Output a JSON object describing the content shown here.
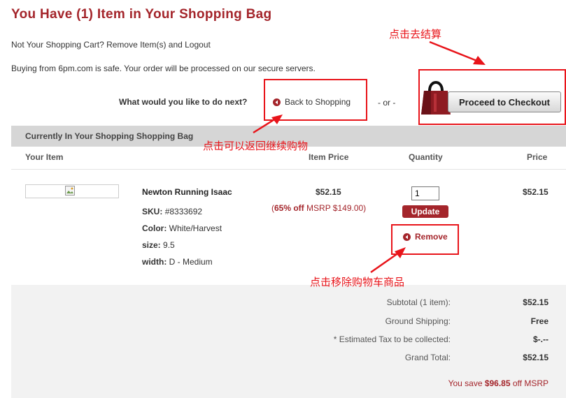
{
  "header": {
    "title": "You Have (1) Item in Your Shopping Bag",
    "not_your_cart": "Not Your Shopping Cart? Remove Item(s) and Logout",
    "secure_note": "Buying from 6pm.com is safe. Your order will be processed on our secure servers."
  },
  "next_steps": {
    "question": "What would you like to do next?",
    "back_label": "Back to Shopping",
    "or_label": "- or -",
    "checkout_label": "Proceed to Checkout"
  },
  "annotations": {
    "checkout": "点击去结算",
    "back": "点击可以返回继续购物",
    "remove": "点击移除购物车商品",
    "color": "#e8141a"
  },
  "table": {
    "heading": "Currently In Your Shopping Shopping Bag",
    "columns": [
      "Your Item",
      "Item Price",
      "Quantity",
      "Price"
    ]
  },
  "item": {
    "name": "Newton Running Isaac",
    "sku_label": "SKU:",
    "sku": "#8333692",
    "color_label": "Color:",
    "color": "White/Harvest",
    "size_label": "size:",
    "size": "9.5",
    "width_label": "width:",
    "width": "D - Medium",
    "item_price": "$52.15",
    "discount_open": "(",
    "discount_pct": "65% off",
    "msrp": " MSRP $149.00)",
    "quantity": "1",
    "update_label": "Update",
    "remove_label": "Remove",
    "price": "$52.15"
  },
  "summary": {
    "subtotal_label": "Subtotal (1 item):",
    "subtotal": "$52.15",
    "shipping_label": "Ground Shipping:",
    "shipping": "Free",
    "tax_label": "* Estimated Tax to be collected:",
    "tax": "$-.--",
    "total_label": "Grand Total:",
    "total": "$52.15",
    "save_prefix": "You save ",
    "save_amount": "$96.85",
    "save_suffix": " off MSRP"
  },
  "colors": {
    "brand": "#a4252b",
    "header_bg": "#d6d6d6"
  }
}
